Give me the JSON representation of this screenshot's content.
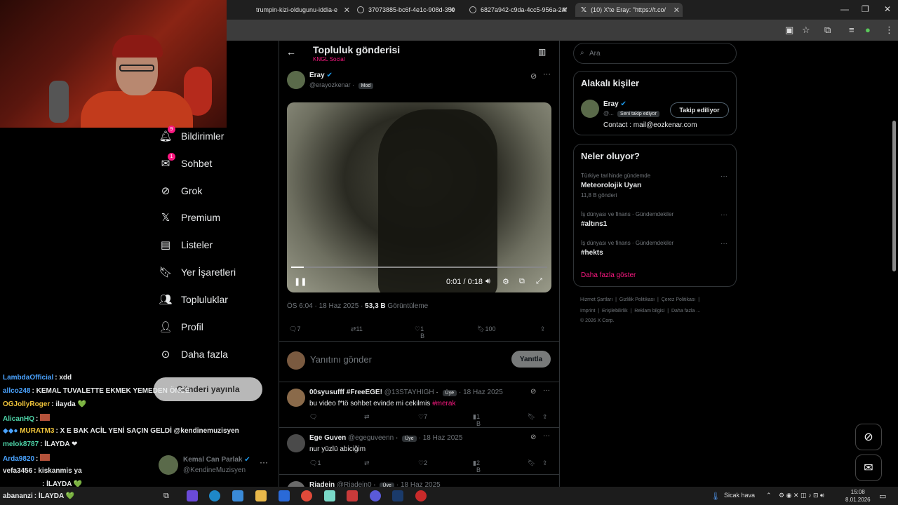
{
  "browser": {
    "tabs": [
      {
        "title": "trumpin-kizi-oldugunu-iddia-e"
      },
      {
        "title": "37073885-bc6f-4e1c-908d-359"
      },
      {
        "title": "6827a942-c9da-4cc5-956a-24f"
      },
      {
        "title": "(10) X'te Eray: \"https://t.co/"
      }
    ]
  },
  "nav": {
    "items": [
      {
        "label": "Bildirimler",
        "badge": "9"
      },
      {
        "label": "Sohbet",
        "badge": "1"
      },
      {
        "label": "Grok"
      },
      {
        "label": "Premium"
      },
      {
        "label": "Listeler"
      },
      {
        "label": "Yer İşaretleri"
      },
      {
        "label": "Topluluklar"
      },
      {
        "label": "Profil"
      },
      {
        "label": "Daha fazla"
      }
    ],
    "post_button": "Gönderi yayınla",
    "account": {
      "name": "Kemal Can Parlak",
      "handle": "@KendineMuzisyen"
    }
  },
  "chat": [
    {
      "user": "LambdaOfficial",
      "msg": ": xdd",
      "color": "#4aa3ff"
    },
    {
      "user": "allco248",
      "msg": ": KEMAL TUVALETTE EKMEK YEMEDEN ÖNCE",
      "color": "#4aa3ff"
    },
    {
      "user": "OGJollyRoger",
      "msg": ": ilayda 💚",
      "color": "#f0c43a"
    },
    {
      "user": "AlicanHQ",
      "msg": ":",
      "color": "#4ed4a8"
    },
    {
      "user": "MURATM3",
      "msg": ": X E BAK ACİL YENİ SAÇIN GELDİ @kendinemuzisyen",
      "color": "#f0c43a"
    },
    {
      "user": "melok8787",
      "msg": ": İLAYDA ❤",
      "color": "#4ed4a8"
    },
    {
      "user": "Arda9820",
      "msg": ":",
      "color": "#4aa3ff"
    },
    {
      "user": "vefa3456",
      "msg": ": kiskanmis ya",
      "color": "#e7e9ea"
    },
    {
      "user": "",
      "msg": ": İLAYDA 💚",
      "color": "#e7e9ea"
    },
    {
      "user": "abananzi",
      "msg": ": İLAYDA 💚",
      "color": "#e7e9ea"
    }
  ],
  "post": {
    "header_title": "Topluluk gönderisi",
    "header_sub": "KNGL Social",
    "author_name": "Eray",
    "author_handle": "@erayozkenar",
    "author_tag": "Mod",
    "video_time": "0:01 / 0:18",
    "video_progress": 0.05,
    "timestamp": "ÖS 6:04 · 18 Haz 2025 · ",
    "views": "53,3 B",
    "views_label": "Görüntüleme",
    "replies": "7",
    "reposts": "11",
    "likes": "1 B",
    "bookmarks": "100",
    "reply_placeholder": "Yanıtını gönder",
    "reply_button": "Yanıtla"
  },
  "replies": [
    {
      "name": "00syusufff #FreeEGE!",
      "handle": "@13STAYHIGH",
      "tag": "Üye",
      "date": "· 18 Haz 2025",
      "text": "bu video f*tö sohbet evinde mi cekilmis",
      "hashtag": "#merak",
      "likes": "7",
      "views": "1 B",
      "replies": "",
      "reposts": ""
    },
    {
      "name": "Ege Guven",
      "handle": "@egeguveenn",
      "tag": "Üye",
      "date": "· 18 Haz 2025",
      "text": "nur yüzlü abiciğim",
      "hashtag": "",
      "likes": "2",
      "views": "2 B",
      "replies": "1",
      "reposts": ""
    },
    {
      "name": "Riadein",
      "handle": "@Riadein0",
      "tag": "Üye",
      "date": "· 18 Haz 2025",
      "text": "",
      "hashtag": "",
      "likes": "",
      "views": "",
      "replies": "",
      "reposts": ""
    }
  ],
  "sidebar": {
    "search_placeholder": "Ara",
    "related_title": "Alakalı kişiler",
    "related_name": "Eray",
    "related_handle": "@...",
    "related_follows_you": "Seni takip ediyor",
    "related_button": "Takip ediliyor",
    "related_bio": "Contact : mail@eozkenar.com",
    "trends_title": "Neler oluyor?",
    "trends": [
      {
        "meta": "Türkiye tarihinde gündemde",
        "name": "Meteorolojik Uyarı",
        "count": "11,8 B gönderi"
      },
      {
        "meta": "İş dünyası ve finans · Gündemdekiler",
        "name": "#altıns1",
        "count": ""
      },
      {
        "meta": "İş dünyası ve finans · Gündemdekiler",
        "name": "#hekts",
        "count": ""
      }
    ],
    "show_more": "Daha fazla göster",
    "footer": {
      "line1": [
        "Hizmet Şartları",
        "Gizlilik Politikası",
        "Çerez Politikası"
      ],
      "line2": [
        "Imprint",
        "Erişilebilirlik",
        "Reklam bilgisi",
        "Daha fazla ..."
      ],
      "copyright": "© 2026 X Corp."
    }
  },
  "taskbar": {
    "weather": "Sicak hava",
    "time": "15:08",
    "date": "8.01.2026"
  },
  "colors": {
    "accent": "#f91880",
    "verified": "#1d9bf0",
    "background": "#000000",
    "border": "#2f3336"
  }
}
